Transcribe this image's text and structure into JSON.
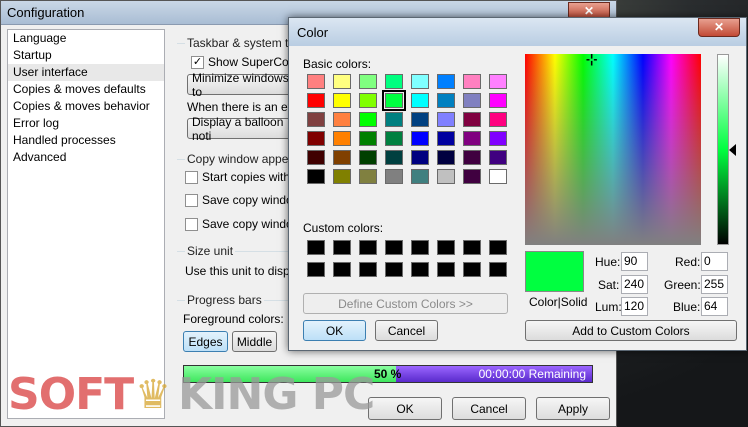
{
  "config": {
    "title": "Configuration",
    "close": "✕",
    "sidebar": [
      "Language",
      "Startup",
      "User interface",
      "Copies & moves defaults",
      "Copies & moves behavior",
      "Error log",
      "Handled processes",
      "Advanced"
    ],
    "taskbar_group": "Taskbar & system tray",
    "show_supercopier": "Show SuperCopier",
    "minimize_btn": "Minimize windows to",
    "when_event": "When there is an eve",
    "balloon_btn": "Display a balloon noti",
    "copy_window_group": "Copy window appeara",
    "start_copies": "Start copies with c",
    "save_copy_1": "Save copy window",
    "save_copy_2": "Save copy window",
    "size_unit_group": "Size unit",
    "size_unit_text": "Use this unit to display",
    "progress_group": "Progress bars",
    "foreground_colors": "Foreground colors:",
    "edges_btn": "Edges",
    "middle_btn": "Middle",
    "progress_value": 50,
    "progress_pct": "50 %",
    "progress_remaining": "00:00:00 Remaining",
    "ok": "OK",
    "cancel": "Cancel",
    "apply": "Apply"
  },
  "dialog": {
    "title": "Color",
    "close": "✕",
    "basic_colors_label": "Basic colors:",
    "custom_colors_label": "Custom colors:",
    "define_custom": "Define Custom Colors >>",
    "ok": "OK",
    "cancel": "Cancel",
    "color_solid": "Color|Solid",
    "hue_label": "Hue:",
    "hue": "90",
    "sat_label": "Sat:",
    "sat": "240",
    "lum_label": "Lum:",
    "lum": "120",
    "red_label": "Red:",
    "red": "0",
    "green_label": "Green:",
    "green": "255",
    "blue_label": "Blue:",
    "blue": "64",
    "add_custom": "Add to Custom Colors",
    "selected_color": "#00ff40",
    "basic_colors": [
      "#ff8080",
      "#ffff80",
      "#80ff80",
      "#00ff80",
      "#80ffff",
      "#0080ff",
      "#ff80c0",
      "#ff80ff",
      "#ff0000",
      "#ffff00",
      "#80ff00",
      "#00ff40",
      "#00ffff",
      "#0080c0",
      "#8080c0",
      "#ff00ff",
      "#804040",
      "#ff8040",
      "#00ff00",
      "#008080",
      "#004080",
      "#8080ff",
      "#800040",
      "#ff0080",
      "#800000",
      "#ff8000",
      "#008000",
      "#008040",
      "#0000ff",
      "#0000a0",
      "#800080",
      "#8000ff",
      "#400000",
      "#804000",
      "#004000",
      "#004040",
      "#000080",
      "#000040",
      "#400040",
      "#400080",
      "#000000",
      "#808000",
      "#808040",
      "#808080",
      "#408080",
      "#c0c0c0",
      "#400040",
      "#ffffff"
    ],
    "selected_index": 11,
    "custom_colors": [
      "#000000",
      "#000000",
      "#000000",
      "#000000",
      "#000000",
      "#000000",
      "#000000",
      "#000000",
      "#000000",
      "#000000",
      "#000000",
      "#000000",
      "#000000",
      "#000000",
      "#000000",
      "#000000"
    ]
  },
  "watermark": {
    "part1": "SOFT",
    "part2": "KING PC"
  }
}
